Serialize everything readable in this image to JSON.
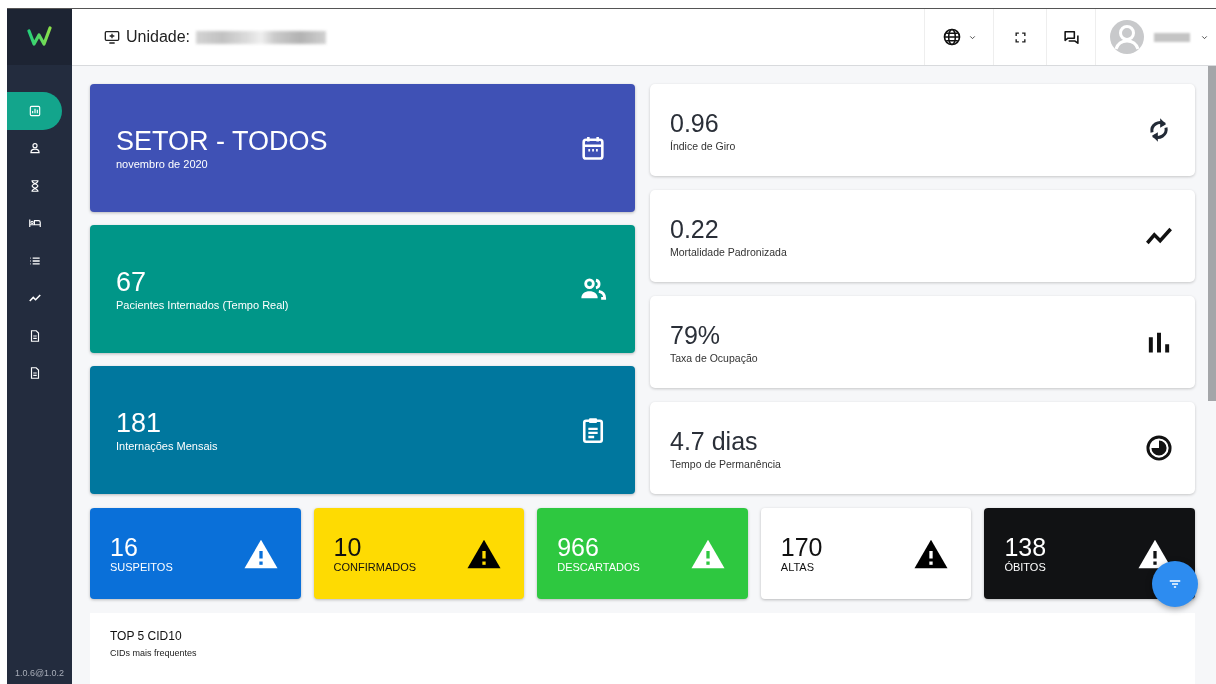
{
  "header": {
    "unit_label": "Unidade:"
  },
  "sidebar": {
    "items": [
      {
        "selected": true
      },
      {
        "selected": false
      },
      {
        "selected": false
      },
      {
        "selected": false
      },
      {
        "selected": false
      },
      {
        "selected": false
      },
      {
        "selected": false
      },
      {
        "selected": false
      }
    ],
    "version": "1.0.6@1.0.2"
  },
  "summary_cards": [
    {
      "value": "SETOR - TODOS",
      "label": "novembro de 2020",
      "color": "#3f51b5"
    },
    {
      "value": "67",
      "label": "Pacientes Internados (Tempo Real)",
      "color": "#009688"
    },
    {
      "value": "181",
      "label": "Internações Mensais",
      "color": "#00779e"
    }
  ],
  "indicator_cards": [
    {
      "value": "0.96",
      "label": "Índice de Giro"
    },
    {
      "value": "0.22",
      "label": "Mortalidade Padronizada"
    },
    {
      "value": "79%",
      "label": "Taxa de Ocupação"
    },
    {
      "value": "4.7 dias",
      "label": "Tempo de Permanência"
    }
  ],
  "alert_cards": [
    {
      "value": "16",
      "label": "SUSPEITOS",
      "color": "#0a70d9"
    },
    {
      "value": "10",
      "label": "CONFIRMADOS",
      "color": "#fedb02"
    },
    {
      "value": "966",
      "label": "DESCARTADOS",
      "color": "#2ec840"
    },
    {
      "value": "170",
      "label": "ALTAS",
      "color": "#ffffff"
    },
    {
      "value": "138",
      "label": "ÓBITOS",
      "color": "#111214"
    }
  ],
  "panel": {
    "title": "TOP 5 CID10",
    "subtitle": "CIDs mais frequentes"
  }
}
